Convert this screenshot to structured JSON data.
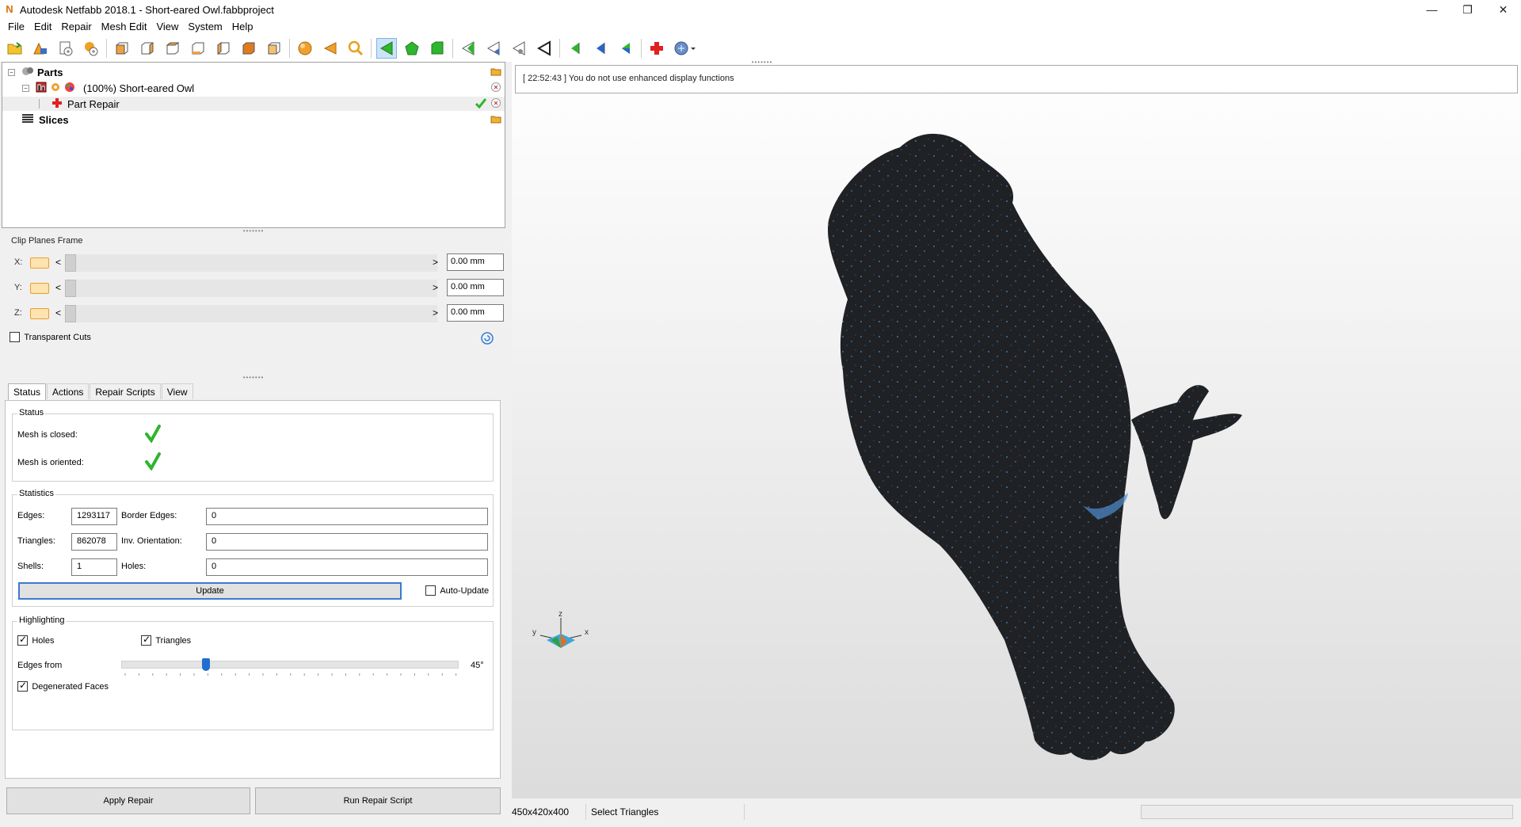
{
  "window": {
    "title": "Autodesk Netfabb 2018.1 - Short-eared Owl.fabbproject",
    "app_icon": "N"
  },
  "menu": [
    "File",
    "Edit",
    "Repair",
    "Mesh Edit",
    "View",
    "System",
    "Help"
  ],
  "tree": {
    "parts_label": "Parts",
    "part_label": "(100%) Short-eared Owl",
    "repair_label": "Part Repair",
    "slices_label": "Slices"
  },
  "clip": {
    "title": "Clip Planes Frame",
    "x_label": "X:",
    "y_label": "Y:",
    "z_label": "Z:",
    "x_value": "0.00 mm",
    "y_value": "0.00 mm",
    "z_value": "0.00 mm",
    "arrow_left": "<",
    "arrow_right": ">",
    "transparent_cuts": "Transparent Cuts"
  },
  "tabs": [
    "Status",
    "Actions",
    "Repair Scripts",
    "View"
  ],
  "status": {
    "group_title": "Status",
    "mesh_closed": "Mesh is closed:",
    "mesh_oriented": "Mesh is oriented:"
  },
  "statistics": {
    "group_title": "Statistics",
    "edges_label": "Edges:",
    "edges_value": "1293117",
    "border_edges_label": "Border Edges:",
    "border_edges_value": "0",
    "triangles_label": "Triangles:",
    "triangles_value": "862078",
    "inv_orientation_label": "Inv. Orientation:",
    "inv_orientation_value": "0",
    "shells_label": "Shells:",
    "shells_value": "1",
    "holes_label": "Holes:",
    "holes_value": "0",
    "update_button": "Update",
    "auto_update": "Auto-Update"
  },
  "highlighting": {
    "group_title": "Highlighting",
    "holes": "Holes",
    "triangles": "Triangles",
    "edges_from": "Edges from",
    "edges_from_value": "45°",
    "edges_from_fraction": 0.25,
    "degenerated_faces": "Degenerated Faces"
  },
  "buttons": {
    "apply_repair": "Apply Repair",
    "run_repair_script": "Run Repair Script"
  },
  "log": {
    "message": "[ 22:52:43 ] You do not use enhanced display functions"
  },
  "axis": {
    "z": "z",
    "y": "y",
    "x": "x"
  },
  "statusbar": {
    "dimensions": "450x420x400",
    "mode": "Select Triangles"
  },
  "colors": {
    "model": "#1f2124",
    "model_highlight": "#4f8fd0",
    "accent": "#1e6fd0",
    "check_green": "#2fb52f"
  }
}
